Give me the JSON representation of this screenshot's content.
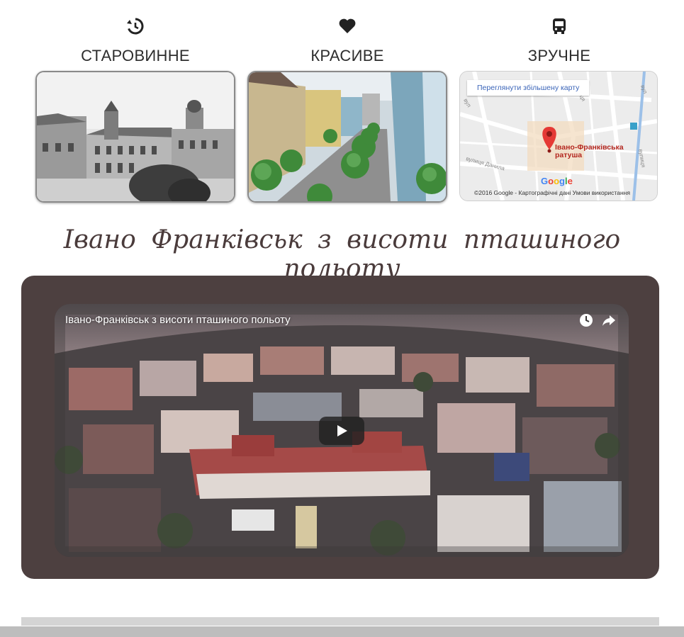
{
  "features": [
    {
      "icon": "history-icon",
      "title": "СТАРОВИННЕ",
      "image": "old-town-photo"
    },
    {
      "icon": "heart-icon",
      "title": "КРАСИВЕ",
      "image": "street-aerial-photo"
    },
    {
      "icon": "bus-icon",
      "title": "ЗРУЧНЕ",
      "image": "map-embed"
    }
  ],
  "map": {
    "view_larger_link": "Переглянути збільшену карту",
    "marker_label": "Івано-Франківська ратуша",
    "google_logo": "Google",
    "footer": "©2016 Google - Картографічні дані     Умови використання",
    "street_labels": [
      "вул",
      "вулиця",
      "вулиця",
      "вул",
      "вулиця Данила"
    ]
  },
  "headline": "Івано Франківськ з висоти пташиного польоту",
  "video": {
    "title": "Івано-Франківськ з висоти пташиного польоту",
    "icons": [
      "watch-later-icon",
      "share-icon",
      "play-icon"
    ]
  },
  "colors": {
    "video_frame": "#4d4040",
    "headline": "#4a3b3b",
    "map_marker": "#e53935",
    "link": "#3a64b8"
  }
}
